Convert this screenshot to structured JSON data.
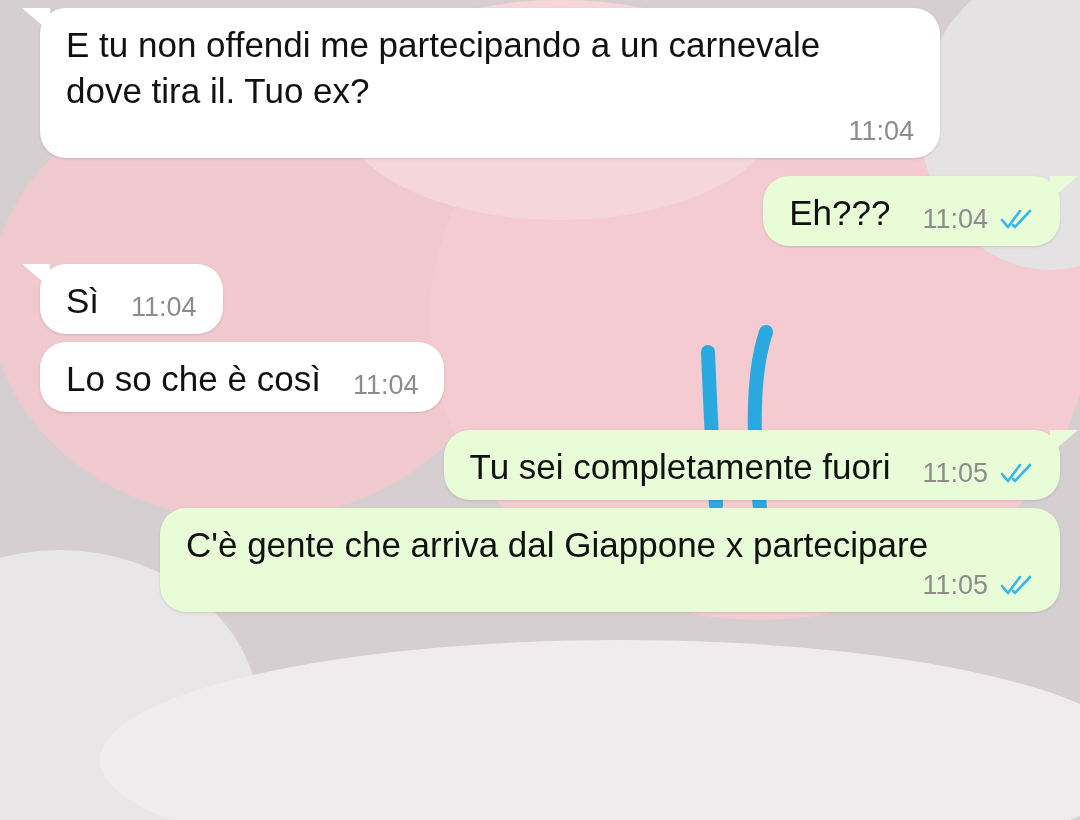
{
  "messages": [
    {
      "kind": "incoming",
      "tail": true,
      "text": "E tu non offendi me partecipando a un carnevale dove tira il. Tuo ex?",
      "time": "11:04"
    },
    {
      "kind": "outgoing",
      "tail": true,
      "text": "Eh???",
      "time": "11:04",
      "read": true
    },
    {
      "kind": "incoming",
      "tail": true,
      "text": "Sì",
      "time": "11:04"
    },
    {
      "kind": "incoming",
      "tail": false,
      "text": "Lo so che è così",
      "time": "11:04"
    },
    {
      "kind": "outgoing",
      "tail": true,
      "text": "Tu sei completamente fuori",
      "time": "11:05",
      "read": true
    },
    {
      "kind": "outgoing",
      "tail": false,
      "text": "C'è gente che arriva dal Giappone x partecipare",
      "time": "11:05",
      "read": true
    }
  ]
}
